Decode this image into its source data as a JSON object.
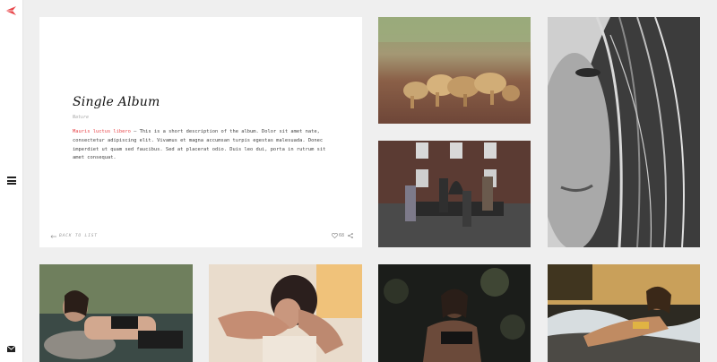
{
  "nav": {
    "logo_icon": "bird-logo-icon",
    "menu_icon": "hamburger-menu-icon",
    "mail_icon": "envelope-icon"
  },
  "album": {
    "title": "Single Album",
    "category": "Nature",
    "description_link": "Mauris luctus libero",
    "description_text": " – This is a short description of the album. Dolor sit amet nate, consectetur adipiscing elit. Vivamus et magna accumsan turpis egestas malesuada. Donec imperdiet ut quam sed faucibus. Sed at placerat odio. Duis leo dui, porta in rutrum sit amet consequat.",
    "back_label": "BACK TO LIST",
    "likes": "68"
  },
  "colors": {
    "accent": "#e8474b",
    "background": "#efefef",
    "card": "#ffffff"
  },
  "photos": [
    {
      "id": "lions",
      "subject": "lions-photo"
    },
    {
      "id": "group",
      "subject": "group-on-bench-photo"
    },
    {
      "id": "face",
      "subject": "bw-face-portrait-photo"
    },
    {
      "id": "lake",
      "subject": "woman-by-lake-photo"
    },
    {
      "id": "bath",
      "subject": "woman-in-bath-photo"
    },
    {
      "id": "forest",
      "subject": "woman-in-dark-forest-photo"
    },
    {
      "id": "beach",
      "subject": "woman-on-beach-photo"
    }
  ]
}
